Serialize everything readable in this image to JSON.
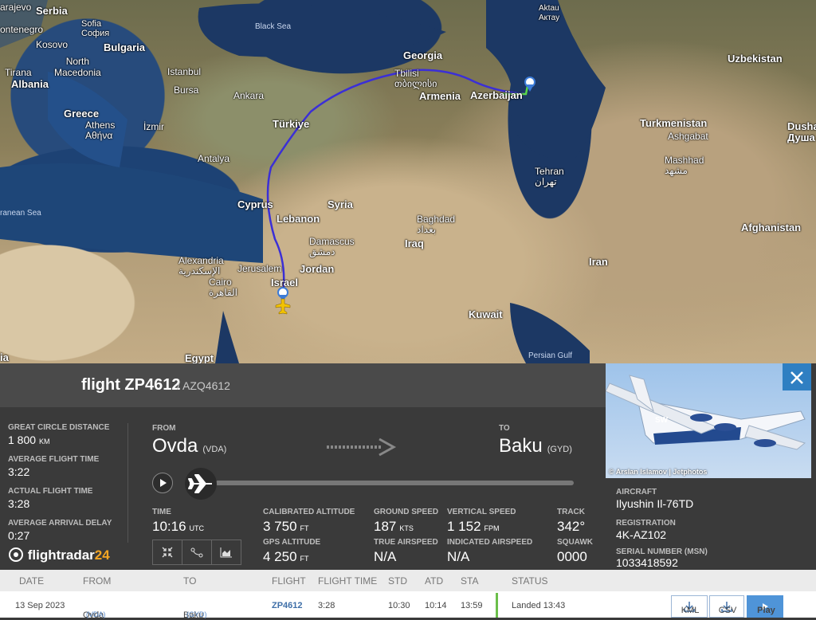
{
  "map": {
    "labels": {
      "sarajevo": "arajevo",
      "serbia": "Serbia",
      "montenegro": "ontenegro",
      "sofia": "Sofia\nСофия",
      "kosovo": "Kosovo",
      "bulgaria": "Bulgaria",
      "north_macedonia": "North\nMacedonia",
      "tirana": "Tirana",
      "albania": "Albania",
      "istanbul": "Istanbul",
      "black_sea": "Black Sea",
      "georgia": "Georgia",
      "tbilisi": "Tbilisi\nთბილისი",
      "armenia": "Armenia",
      "azerbaijan": "Azerbaijan",
      "aktau": "Aktau\nАктау",
      "uzbekistan": "Uzbekistan",
      "bursa": "Bursa",
      "ankara": "Ankara",
      "greece": "Greece",
      "athens": "Athens\nΑθήνα",
      "izmir": "İzmir",
      "turkiye": "Türkiye",
      "turkmenistan": "Turkmenistan",
      "ashgabat": "Ashgabat",
      "dushanbe": "Dusha\nДуша",
      "antalya": "Antalya",
      "tehran": "Tehran\nتهران",
      "mashhad": "Mashhad\nمشهد",
      "mediterranean": "ranean Sea",
      "cyprus": "Cyprus",
      "syria": "Syria",
      "lebanon": "Lebanon",
      "baghdad": "Baghdad\nبغداد",
      "afghanistan": "Afghanistan",
      "damascus": "Damascus\nدمشق",
      "iraq": "Iraq",
      "alexandria": "Alexandria\nالإسكندرية",
      "jerusalem": "Jerusalem",
      "jordan": "Jordan",
      "iran": "Iran",
      "cairo": "Cairo\nالقاهرة",
      "israel": "Israel",
      "kuwait": "Kuwait",
      "persian_gulf": "Persian Gulf",
      "egypt": "Egypt",
      "ia": "ia"
    }
  },
  "flight": {
    "title": "flight ZP4612",
    "subtitle": "/ AZQ4612",
    "stats": [
      {
        "label": "GREAT CIRCLE DISTANCE",
        "value": "1 800",
        "unit": "KM"
      },
      {
        "label": "AVERAGE FLIGHT TIME",
        "value": "3:22"
      },
      {
        "label": "ACTUAL FLIGHT TIME",
        "value": "3:28"
      },
      {
        "label": "AVERAGE ARRIVAL DELAY",
        "value": "0:27"
      }
    ],
    "from_label": "FROM",
    "from_city": "Ovda",
    "from_code": "(VDA)",
    "to_label": "TO",
    "to_city": "Baku",
    "to_code": "(GYD)",
    "progress": 0.0,
    "time_label": "TIME",
    "time_value": "10:16",
    "time_unit": "UTC",
    "cal_alt_label": "CALIBRATED ALTITUDE",
    "cal_alt_value": "3 750",
    "cal_alt_unit": "FT",
    "gps_alt_label": "GPS ALTITUDE",
    "gps_alt_value": "4 250",
    "gps_alt_unit": "FT",
    "ground_speed_label": "GROUND SPEED",
    "ground_speed_value": "187",
    "ground_speed_unit": "KTS",
    "true_airspeed_label": "TRUE AIRSPEED",
    "true_airspeed_value": "N/A",
    "vertical_speed_label": "VERTICAL SPEED",
    "vertical_speed_value": "1 152",
    "vertical_speed_unit": "FPM",
    "indicated_airspeed_label": "INDICATED AIRSPEED",
    "indicated_airspeed_value": "N/A",
    "track_label": "TRACK",
    "track_value": "342°",
    "squawk_label": "SQUAWK",
    "squawk_value": "0000",
    "logo_a": "flightradar",
    "logo_b": "24"
  },
  "aircraft": {
    "photo_credit": "© Arslan Islamov | Jetphotos",
    "aircraft_label": "AIRCRAFT",
    "aircraft_value": "Ilyushin Il-76TD",
    "registration_label": "REGISTRATION",
    "registration_value": "4K-AZ102",
    "serial_label": "SERIAL NUMBER (MSN)",
    "serial_value": "1033418592"
  },
  "table": {
    "headers": {
      "date": "DATE",
      "from": "FROM",
      "to": "TO",
      "flight": "FLIGHT",
      "flight_time": "FLIGHT TIME",
      "std": "STD",
      "atd": "ATD",
      "sta": "STA",
      "status": "STATUS"
    },
    "row": {
      "date": "13 Sep 2023",
      "from": "Ovda",
      "from_code": "(VDA)",
      "to": "Baku",
      "to_code": "(GYD)",
      "flight": "ZP4612",
      "flight_time": "3:28",
      "std": "10:30",
      "atd": "10:14",
      "sta": "13:59",
      "status": "Landed 13:43",
      "kml": "KML",
      "csv": "CSV",
      "play": "Play"
    }
  },
  "colors": {
    "accent": "#2f7fc2",
    "route": "#3b2fd6",
    "landed": "#6bbf4a",
    "logo_orange": "#f5a623"
  }
}
